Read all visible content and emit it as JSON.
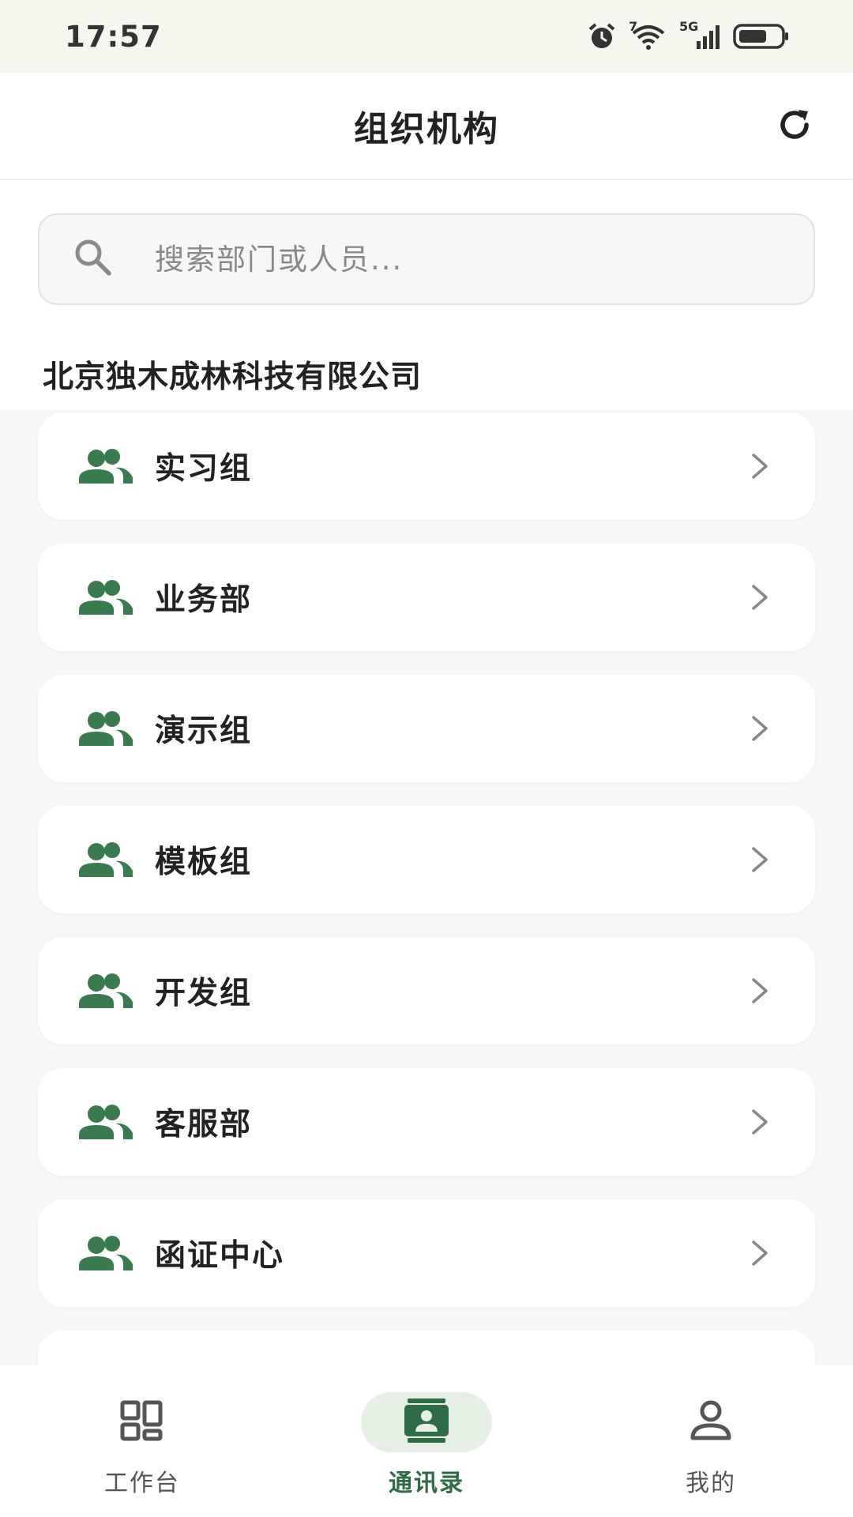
{
  "status_bar": {
    "time": "17:57",
    "icons": [
      "alarm-icon",
      "wifi-icon",
      "signal-5g-icon",
      "battery-icon"
    ],
    "wifi_label": "7",
    "network_label": "5G"
  },
  "header": {
    "title": "组织机构",
    "refresh_icon": "refresh-icon"
  },
  "search": {
    "placeholder": "搜索部门或人员...",
    "value": ""
  },
  "company": {
    "name": "北京独木成林科技有限公司"
  },
  "departments": [
    {
      "label": "实习组"
    },
    {
      "label": "业务部"
    },
    {
      "label": "演示组"
    },
    {
      "label": "模板组"
    },
    {
      "label": "开发组"
    },
    {
      "label": "客服部"
    },
    {
      "label": "函证中心"
    }
  ],
  "bottom_nav": {
    "items": [
      {
        "label": "工作台",
        "icon": "dashboard-icon",
        "active": false
      },
      {
        "label": "通讯录",
        "icon": "contacts-icon",
        "active": true
      },
      {
        "label": "我的",
        "icon": "person-icon",
        "active": false
      }
    ]
  },
  "colors": {
    "accent": "#2f6b45",
    "icon_green": "#3a7a4f",
    "active_pill": "#e6efe4",
    "status_bar_bg": "#f3f7ee",
    "page_bg": "#f7f7f7"
  }
}
